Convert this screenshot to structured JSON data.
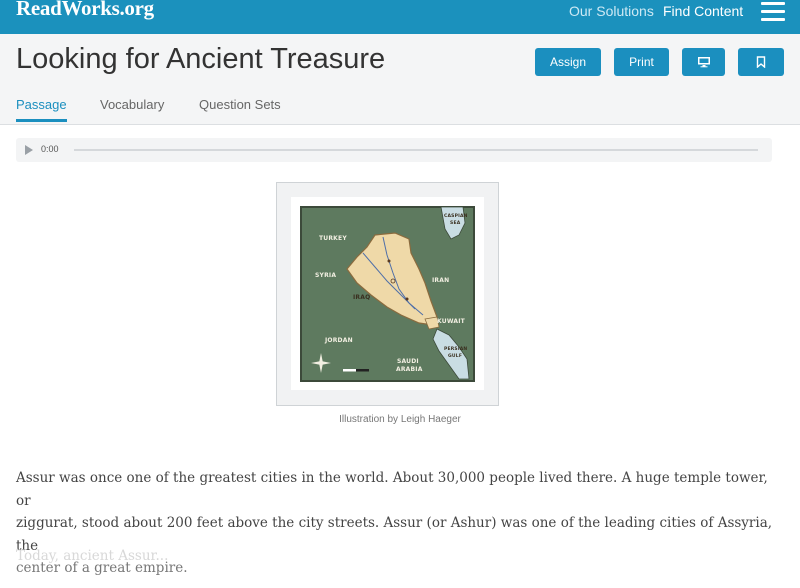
{
  "topbar": {
    "logo": "ReadWorks.org",
    "nav": [
      "Our Solutions",
      "Find Content"
    ],
    "menu_icon": "hamburger-menu-icon"
  },
  "header": {
    "title": "Looking for Ancient Treasure",
    "buttons": {
      "assign": "Assign",
      "print": "Print",
      "present_icon": "monitor-icon",
      "bookmark_icon": "bookmark-icon"
    },
    "tabs": [
      "Passage",
      "Vocabulary",
      "Question Sets"
    ],
    "active_tab": "Passage"
  },
  "audio": {
    "time": "0:00",
    "play_icon": "play-icon",
    "progress": 0
  },
  "figure": {
    "map_labels": {
      "turkey": "TURKEY",
      "syria": "SYRIA",
      "iraq": "IRAQ",
      "iran": "IRAN",
      "jordan": "JORDAN",
      "kuwait": "KUWAIT",
      "saudi1": "SAUDI",
      "saudi2": "ARABIA",
      "caspian1": "CASPIAN",
      "caspian2": "SEA",
      "gulf1": "PERSIAN",
      "gulf2": "GULF"
    },
    "caption": "Illustration by Leigh Haeger"
  },
  "passage": {
    "line1": "Assur was once one of the greatest cities in the world. About 30,000 people lived there. A huge temple tower, or",
    "line2": "ziggurat, stood about 200 feet above the city streets. Assur (or Ashur) was one of the leading cities of Assyria, the",
    "line3": "center of a great empire.",
    "faded": "Today, ancient Assur..."
  },
  "colors": {
    "brand": "#1b91bd",
    "button": "#1b8fbf",
    "map_green": "#5e7a5f",
    "map_iraq": "#efd9a8",
    "water": "#c9dde3"
  }
}
